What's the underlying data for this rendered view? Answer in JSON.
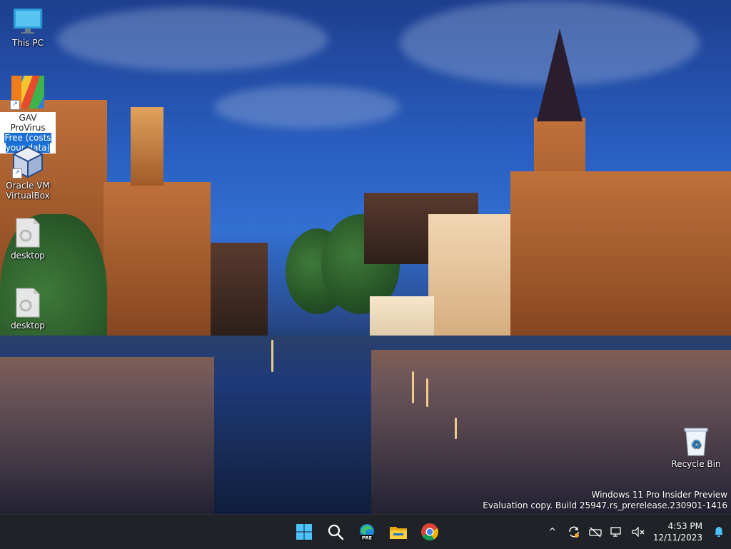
{
  "desktop": {
    "icons": [
      {
        "label": "This PC",
        "icon": "monitor-icon"
      },
      {
        "label_line1": "GAV ProVirus",
        "label_highlight1": "Free (costs",
        "label_highlight2": "your data)",
        "icon": "colorful-app-icon"
      },
      {
        "label_line1": "Oracle VM",
        "label_line2": "VirtualBox",
        "icon": "virtualbox-cube-icon"
      },
      {
        "label": "desktop",
        "icon": "file-icon"
      },
      {
        "label": "desktop",
        "icon": "file-icon"
      },
      {
        "label": "Recycle Bin",
        "icon": "recycle-bin-icon"
      }
    ],
    "watermark": {
      "line1": "Windows 11 Pro Insider Preview",
      "line2": "Evaluation copy. Build 25947.rs_prerelease.230901-1416"
    }
  },
  "taskbar": {
    "apps": [
      "start-icon",
      "search-icon",
      "edge-preview-icon",
      "file-explorer-icon",
      "chrome-icon"
    ],
    "edge_badge": "PRE",
    "tray": {
      "chevron": "^",
      "clock_time": "4:53 PM",
      "clock_date": "12/11/2023"
    }
  }
}
